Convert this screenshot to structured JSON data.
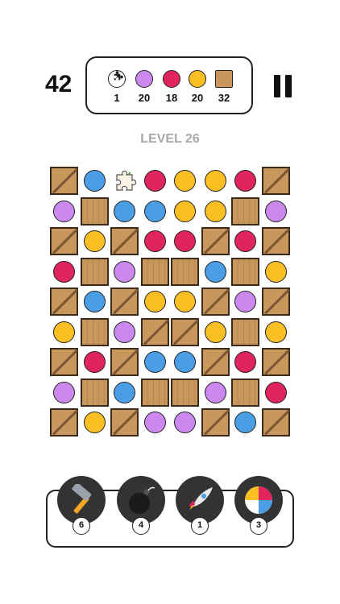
{
  "hud": {
    "moves": "42",
    "goals": [
      {
        "icon": "puzzle-icon",
        "count": "1"
      },
      {
        "icon": "purple-ball-icon",
        "color": "#cc88ee",
        "count": "20"
      },
      {
        "icon": "red-ball-icon",
        "color": "#e0245e",
        "count": "18"
      },
      {
        "icon": "yellow-ball-icon",
        "color": "#fbbf24",
        "count": "20"
      },
      {
        "icon": "crate-icon",
        "count": "32"
      }
    ],
    "pause_icon": "pause-icon"
  },
  "level_label": "LEVEL 26",
  "colors": {
    "blue": "#4a9ee6",
    "red": "#e0245e",
    "yellow": "#fbbf24",
    "purple": "#cc88ee",
    "crate": "#c9965e"
  },
  "board": [
    [
      "X",
      "b",
      "P",
      "r",
      "y",
      "y",
      "r",
      "X"
    ],
    [
      "p",
      "C",
      "b",
      "b",
      "y",
      "y",
      "C",
      "p"
    ],
    [
      "X",
      "y",
      "X",
      "r",
      "r",
      "X",
      "r",
      "X"
    ],
    [
      "r",
      "C",
      "p",
      "C",
      "C",
      "b",
      "C",
      "y"
    ],
    [
      "X",
      "b",
      "X",
      "y",
      "y",
      "X",
      "p",
      "X"
    ],
    [
      "y",
      "C",
      "p",
      "X",
      "X",
      "y",
      "C",
      "y"
    ],
    [
      "X",
      "r",
      "X",
      "b",
      "b",
      "X",
      "r",
      "X"
    ],
    [
      "p",
      "C",
      "b",
      "C",
      "C",
      "p",
      "C",
      "r"
    ],
    [
      "X",
      "y",
      "X",
      "p",
      "p",
      "X",
      "b",
      "X"
    ]
  ],
  "boosters": [
    {
      "name": "hammer",
      "icon": "hammer-icon",
      "count": "6"
    },
    {
      "name": "bomb",
      "icon": "bomb-icon",
      "count": "4"
    },
    {
      "name": "rocket",
      "icon": "rocket-icon",
      "count": "1"
    },
    {
      "name": "beach-ball",
      "icon": "beach-ball-icon",
      "count": "3"
    }
  ]
}
